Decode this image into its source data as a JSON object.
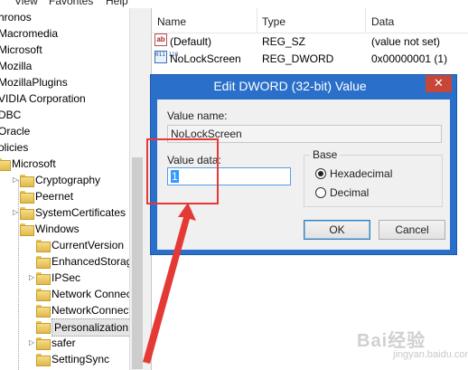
{
  "menu": [
    "View",
    "Favorites",
    "Help"
  ],
  "tree": [
    {
      "label": "hronos",
      "indent": 0,
      "folder": false,
      "expander": false
    },
    {
      "label": "Macromedia",
      "indent": 0,
      "folder": false,
      "expander": false
    },
    {
      "label": "Microsoft",
      "indent": 0,
      "folder": false,
      "expander": false
    },
    {
      "label": "Mozilla",
      "indent": 0,
      "folder": false,
      "expander": false
    },
    {
      "label": "MozillaPlugins",
      "indent": 0,
      "folder": false,
      "expander": false
    },
    {
      "label": "VIDIA Corporation",
      "indent": 0,
      "folder": false,
      "expander": false
    },
    {
      "label": "DBC",
      "indent": 0,
      "folder": false,
      "expander": false
    },
    {
      "label": "Oracle",
      "indent": 0,
      "folder": false,
      "expander": false
    },
    {
      "label": "olicies",
      "indent": 0,
      "folder": false,
      "expander": false
    },
    {
      "label": "Microsoft",
      "indent": 1,
      "folder": true,
      "expander": false
    },
    {
      "label": "Cryptography",
      "indent": 2,
      "folder": true,
      "expander": true
    },
    {
      "label": "Peernet",
      "indent": 2,
      "folder": true,
      "expander": false
    },
    {
      "label": "SystemCertificates",
      "indent": 2,
      "folder": true,
      "expander": true
    },
    {
      "label": "Windows",
      "indent": 2,
      "folder": true,
      "expander": false
    },
    {
      "label": "CurrentVersion",
      "indent": 3,
      "folder": true,
      "expander": false
    },
    {
      "label": "EnhancedStorage",
      "indent": 3,
      "folder": true,
      "expander": false
    },
    {
      "label": "IPSec",
      "indent": 3,
      "folder": true,
      "expander": true
    },
    {
      "label": "Network Connect",
      "indent": 3,
      "folder": true,
      "expander": false
    },
    {
      "label": "NetworkConnect",
      "indent": 3,
      "folder": true,
      "expander": false
    },
    {
      "label": "Personalization",
      "indent": 3,
      "folder": true,
      "expander": false,
      "selected": true
    },
    {
      "label": "safer",
      "indent": 3,
      "folder": true,
      "expander": true
    },
    {
      "label": "SettingSync",
      "indent": 3,
      "folder": true,
      "expander": false
    }
  ],
  "list": {
    "columns": [
      "Name",
      "Type",
      "Data"
    ],
    "rows": [
      {
        "icon": "string-value-icon",
        "icon_text": "ab",
        "name": "(Default)",
        "type": "REG_SZ",
        "data": "(value not set)"
      },
      {
        "icon": "binary-value-icon",
        "icon_text": "011 110",
        "name": "NoLockScreen",
        "type": "REG_DWORD",
        "data": "0x00000001 (1)"
      }
    ]
  },
  "dialog": {
    "title": "Edit DWORD (32-bit) Value",
    "close_glyph": "✕",
    "value_name_label": "Value name:",
    "value_name": "NoLockScreen",
    "value_data_label": "Value data:",
    "value_data": "1",
    "base_label": "Base",
    "base_options": [
      "Hexadecimal",
      "Decimal"
    ],
    "base_selected": "Hexadecimal",
    "ok_label": "OK",
    "cancel_label": "Cancel"
  },
  "watermark": {
    "text": "Bai经验",
    "sub": "jingyan.baidu.com"
  },
  "colors": {
    "accent": "#2a6fc9",
    "annotation": "#e53935",
    "close": "#c7463a"
  }
}
